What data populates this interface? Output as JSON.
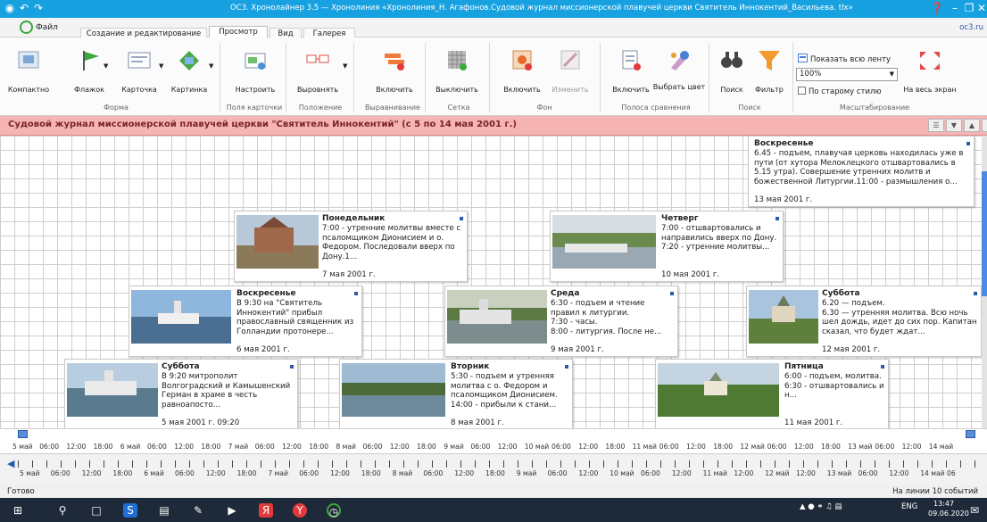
{
  "window": {
    "title": "OC3. Хронолайнер 3.5 — Хронолиния «Хронолиния_Н. Агафонов.Судовой журнал миссионерской плавучей церкви Святитель Иннокентий_Васильева. tlx»"
  },
  "tabs": {
    "file": "Файл",
    "items": [
      "Создание и редактирование",
      "Просмотр",
      "Вид",
      "Галерея"
    ],
    "active": "Просмотр",
    "site": "oc3.ru"
  },
  "ribbon": {
    "buttons": [
      "Компактно",
      "Флажок",
      "Карточка",
      "Картинка",
      "Настроить",
      "Выровнять",
      "Включить",
      "Выключить",
      "Включить",
      "Изменить",
      "Включить",
      "Выбрать цвет",
      "Поиск",
      "Фильтр",
      "На весь экран"
    ],
    "groups": [
      "Форма",
      "Поля карточки",
      "Положение",
      "Выравнивание",
      "Сетка",
      "Фон",
      "Полоса сравнения",
      "Поиск",
      "Масштабирование"
    ],
    "show_all": "Показать всю ленту",
    "zoom": "100%",
    "old_style": "По старому стилю"
  },
  "header": {
    "title": "Судовой журнал миссионерской плавучей церкви \"Святитель Иннокентий\" (с 5 по 14 мая 2001 г.)"
  },
  "events": [
    {
      "title": "Воскресенье",
      "body": "6.45 - подъем, плавучая церковь находилась уже в пути (от хутора Мелоклецкого отшвартовались в 5.15 утра). Совершение утренних молитв и божественной Литургии.11:00 - размышления о...",
      "date": "13 мая 2001 г."
    },
    {
      "title": "Понедельник",
      "body": "7:00 - утренние молитвы вместе с псаломщиком Дионисием и о. Федором. Последовали вверх по Дону.1...",
      "date": "7 мая 2001 г."
    },
    {
      "title": "Четверг",
      "body": "7:00 - отшвартовались и направились вверх по Дону.\n7:20 - утренние молитвы...",
      "date": "10 мая 2001 г."
    },
    {
      "title": "Воскресенье",
      "body": "В 9:30 на \"Святитель Иннокентий\" прибыл православный священник из Голландии протонере...",
      "date": "6 мая 2001 г."
    },
    {
      "title": "Среда",
      "body": "6:30 - подъем и чтение правил к литургии.\n7:30 - часы.\n8:00 - литургия. После не...",
      "date": "9 мая 2001 г."
    },
    {
      "title": "Суббота",
      "body": "6.20 — подъем.\n6.30 — утренняя молитва. Всю ночь шел дождь, идет до сих пор. Капитан сказал, что будет ждат...",
      "date": "12 мая 2001 г."
    },
    {
      "title": "Суббота",
      "body": "В 9:20 митрополит Волгоградский и Камышенский Герман в храме в честь равноапосто...",
      "date": "5 мая 2001 г. 09:20"
    },
    {
      "title": "Вторник",
      "body": "5:30 - подъем и утренняя молитва с о. Федором и псаломщиком Дионисием.\n14:00 - прибыли к стани...",
      "date": "8 мая 2001 г."
    },
    {
      "title": "Пятница",
      "body": "6:00 - подъем, молитва.\n6:30 - отшвартовались и н...",
      "date": "11 мая 2001 г."
    }
  ],
  "ruler_top": [
    "5 май",
    "06:00",
    "12:00",
    "18:00",
    "6 май",
    "06:00",
    "12:00",
    "18:00",
    "7 май",
    "06:00",
    "12:00",
    "18:00",
    "8 май",
    "06:00",
    "12:00",
    "18:00",
    "9 май",
    "06:00",
    "12:00",
    "10 май",
    "06:00",
    "12:00",
    "18:00",
    "11 май",
    "06:00",
    "12:00",
    "18:00",
    "12 май",
    "06:00",
    "12:00",
    "18:00",
    "13 май",
    "06:00",
    "12:00",
    "14 май"
  ],
  "ruler_bottom": [
    "5 май",
    "06:00",
    "12:00",
    "18:00",
    "6 май",
    "06:00",
    "12:00",
    "18:00",
    "7 май",
    "06:00",
    "12:00",
    "18:00",
    "8 май",
    "06:00",
    "12:00",
    "18:00",
    "9 май",
    "06:00",
    "12:00",
    "10 май",
    "06:00",
    "12:00",
    "11 май",
    "12:00",
    "12 май",
    "12:00",
    "13 май",
    "06:00",
    "12:00",
    "14 май 06"
  ],
  "status": {
    "left": "Готово",
    "right": "На линии 10 событий"
  },
  "taskbar": {
    "lang": "ENG",
    "time": "13:47",
    "date": "09.06.2020"
  },
  "colors": {
    "titlebar": "#17a1e0",
    "header": "#f6b4b4",
    "accent": "#2a5aa8"
  }
}
